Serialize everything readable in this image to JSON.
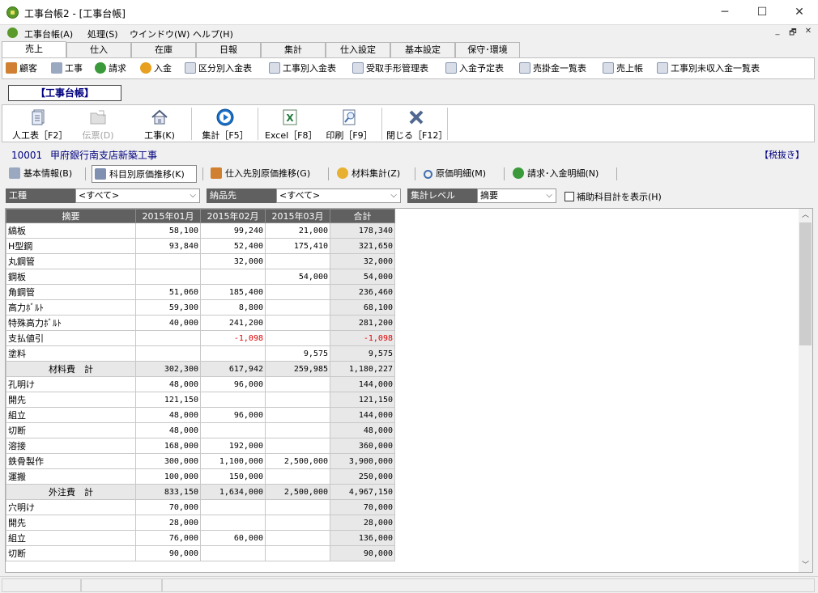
{
  "window": {
    "title": "工事台帳2 - [工事台帳]",
    "minimize": "─",
    "maximize": "☐",
    "close": "✕"
  },
  "menu": [
    "工事台帳(A)",
    "処理(S)",
    "ウインドウ(W)",
    "ヘルプ(H)"
  ],
  "mdi_controls": [
    "_",
    "🗗",
    "✕"
  ],
  "tabs": [
    "売上",
    "仕入",
    "在庫",
    "日報",
    "集計",
    "仕入設定",
    "基本設定",
    "保守･環境"
  ],
  "active_tab": "売上",
  "quick": [
    "顧客",
    "工事",
    "請求",
    "入金",
    "区分別入金表",
    "工事別入金表",
    "受取手形管理表",
    "入金予定表",
    "売掛金一覧表",
    "売上帳",
    "工事別未収入金一覧表"
  ],
  "section_label": "【工事台帳】",
  "big_toolbar": [
    {
      "label": "人工表［F2］",
      "enabled": true,
      "icon": "document-icon"
    },
    {
      "label": "伝票(D)",
      "enabled": false,
      "icon": "folder-icon"
    },
    {
      "label": "工事(K)",
      "enabled": true,
      "icon": "house-icon"
    },
    {
      "label": "集計［F5］",
      "enabled": true,
      "icon": "play-icon"
    },
    {
      "label": "Excel［F8］",
      "enabled": true,
      "icon": "excel-icon"
    },
    {
      "label": "印刷［F9］",
      "enabled": true,
      "icon": "print-preview-icon"
    },
    {
      "label": "閉じる［F12］",
      "enabled": true,
      "icon": "close-icon"
    }
  ],
  "project": {
    "code": "10001",
    "name": "甲府銀行南支店新築工事",
    "tax": "【税抜き】"
  },
  "subtabs": [
    "基本情報(B)",
    "科目別原価推移(K)",
    "仕入先別原価推移(G)",
    "材料集計(Z)",
    "原価明細(M)",
    "請求･入金明細(N)"
  ],
  "active_subtab": "科目別原価推移(K)",
  "filters": {
    "koshu_label": "工種",
    "koshu_value": "<すべて>",
    "nohin_label": "納品先",
    "nohin_value": "<すべて>",
    "level_label": "集計レベル",
    "level_value": "摘要",
    "sub_check_label": "補助科目計を表示(H)"
  },
  "colors": {
    "header_bg": "#606060",
    "subtotal_bg": "#e8e8e8",
    "negative": "#e00000",
    "accent": "#000080"
  },
  "grid": {
    "columns": [
      "摘要",
      "2015年01月",
      "2015年02月",
      "2015年03月",
      "合計"
    ],
    "rows": [
      {
        "name": "縞板",
        "v": [
          "58,100",
          "99,240",
          "21,000",
          "178,340"
        ]
      },
      {
        "name": "H型鋼",
        "v": [
          "93,840",
          "52,400",
          "175,410",
          "321,650"
        ]
      },
      {
        "name": "丸鋼管",
        "v": [
          "",
          "32,000",
          "",
          "32,000"
        ]
      },
      {
        "name": "鋼板",
        "v": [
          "",
          "",
          "54,000",
          "54,000"
        ]
      },
      {
        "name": "角鋼管",
        "v": [
          "51,060",
          "185,400",
          "",
          "236,460"
        ]
      },
      {
        "name": "高力ﾎﾞﾙﾄ",
        "v": [
          "59,300",
          "8,800",
          "",
          "68,100"
        ]
      },
      {
        "name": "特殊高力ﾎﾞﾙﾄ",
        "v": [
          "40,000",
          "241,200",
          "",
          "281,200"
        ]
      },
      {
        "name": "支払値引",
        "v": [
          "",
          "-1,098",
          "",
          "-1,098"
        ],
        "neg": true
      },
      {
        "name": "塗料",
        "v": [
          "",
          "",
          "9,575",
          "9,575"
        ]
      },
      {
        "name": "材料費　計",
        "v": [
          "302,300",
          "617,942",
          "259,985",
          "1,180,227"
        ],
        "subtotal": true
      },
      {
        "name": "孔明け",
        "v": [
          "48,000",
          "96,000",
          "",
          "144,000"
        ]
      },
      {
        "name": "開先",
        "v": [
          "121,150",
          "",
          "",
          "121,150"
        ]
      },
      {
        "name": "組立",
        "v": [
          "48,000",
          "96,000",
          "",
          "144,000"
        ]
      },
      {
        "name": "切断",
        "v": [
          "48,000",
          "",
          "",
          "48,000"
        ]
      },
      {
        "name": "溶接",
        "v": [
          "168,000",
          "192,000",
          "",
          "360,000"
        ]
      },
      {
        "name": "鉄骨製作",
        "v": [
          "300,000",
          "1,100,000",
          "2,500,000",
          "3,900,000"
        ]
      },
      {
        "name": "運搬",
        "v": [
          "100,000",
          "150,000",
          "",
          "250,000"
        ]
      },
      {
        "name": "外注費　計",
        "v": [
          "833,150",
          "1,634,000",
          "2,500,000",
          "4,967,150"
        ],
        "subtotal": true
      },
      {
        "name": "穴明け",
        "v": [
          "70,000",
          "",
          "",
          "70,000"
        ]
      },
      {
        "name": "開先",
        "v": [
          "28,000",
          "",
          "",
          "28,000"
        ]
      },
      {
        "name": "組立",
        "v": [
          "76,000",
          "60,000",
          "",
          "136,000"
        ]
      },
      {
        "name": "切断",
        "v": [
          "90,000",
          "",
          "",
          "90,000"
        ]
      }
    ]
  }
}
